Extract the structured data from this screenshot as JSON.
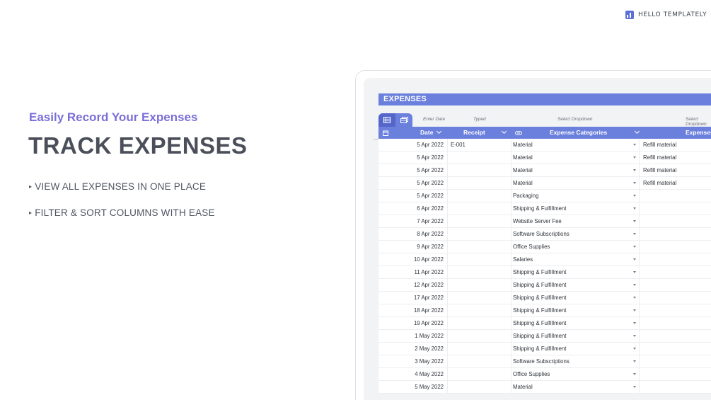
{
  "brand": {
    "name": "HELLO TEMPLATELY",
    "icon": "bar-chart-icon",
    "color": "#5b6fd6"
  },
  "hero": {
    "subtitle": "Easily Record Your Expenses",
    "title": "TRACK EXPENSES",
    "bullets": [
      "VIEW ALL EXPENSES IN ONE PLACE",
      "FILTER & SORT COLUMNS WITH EASE"
    ],
    "accent": "#7a6fd8"
  },
  "sheet": {
    "title": "EXPENSES",
    "header_color": "#6b7fdc",
    "views": [
      {
        "icon": "grid-view-icon",
        "active": true
      },
      {
        "icon": "gallery-view-icon",
        "active": false
      }
    ],
    "hints": [
      "Enter Date",
      "Typed",
      "Select Dropdown",
      "Select Dropdown"
    ],
    "columns": [
      "Date",
      "Receipt",
      "Expense Categories",
      "Expenses"
    ],
    "rows": [
      {
        "date": "5 Apr 2022",
        "receipt": "E-001",
        "category": "Material",
        "expense": "Refill material"
      },
      {
        "date": "5 Apr 2022",
        "receipt": "",
        "category": "Material",
        "expense": "Refill material"
      },
      {
        "date": "5 Apr 2022",
        "receipt": "",
        "category": "Material",
        "expense": "Refill material"
      },
      {
        "date": "5 Apr 2022",
        "receipt": "",
        "category": "Material",
        "expense": "Refill material"
      },
      {
        "date": "5 Apr 2022",
        "receipt": "",
        "category": "Packaging",
        "expense": ""
      },
      {
        "date": "6 Apr 2022",
        "receipt": "",
        "category": "Shipping & Fulfillment",
        "expense": ""
      },
      {
        "date": "7 Apr 2022",
        "receipt": "",
        "category": "Website Server Fee",
        "expense": ""
      },
      {
        "date": "8 Apr 2022",
        "receipt": "",
        "category": "Software Subscriptions",
        "expense": ""
      },
      {
        "date": "9 Apr 2022",
        "receipt": "",
        "category": "Office Supplies",
        "expense": ""
      },
      {
        "date": "10 Apr 2022",
        "receipt": "",
        "category": "Salaries",
        "expense": ""
      },
      {
        "date": "11 Apr 2022",
        "receipt": "",
        "category": "Shipping & Fulfillment",
        "expense": ""
      },
      {
        "date": "12 Apr 2022",
        "receipt": "",
        "category": "Shipping & Fulfillment",
        "expense": ""
      },
      {
        "date": "17 Apr 2022",
        "receipt": "",
        "category": "Shipping & Fulfillment",
        "expense": ""
      },
      {
        "date": "18 Apr 2022",
        "receipt": "",
        "category": "Shipping & Fulfillment",
        "expense": ""
      },
      {
        "date": "19 Apr 2022",
        "receipt": "",
        "category": "Shipping & Fulfillment",
        "expense": ""
      },
      {
        "date": "1 May 2022",
        "receipt": "",
        "category": "Shipping & Fulfillment",
        "expense": ""
      },
      {
        "date": "2 May 2022",
        "receipt": "",
        "category": "Shipping & Fulfillment",
        "expense": ""
      },
      {
        "date": "3 May 2022",
        "receipt": "",
        "category": "Software Subscriptions",
        "expense": ""
      },
      {
        "date": "4 May 2022",
        "receipt": "",
        "category": "Office Supplies",
        "expense": ""
      },
      {
        "date": "5 May 2022",
        "receipt": "",
        "category": "Material",
        "expense": ""
      }
    ]
  }
}
